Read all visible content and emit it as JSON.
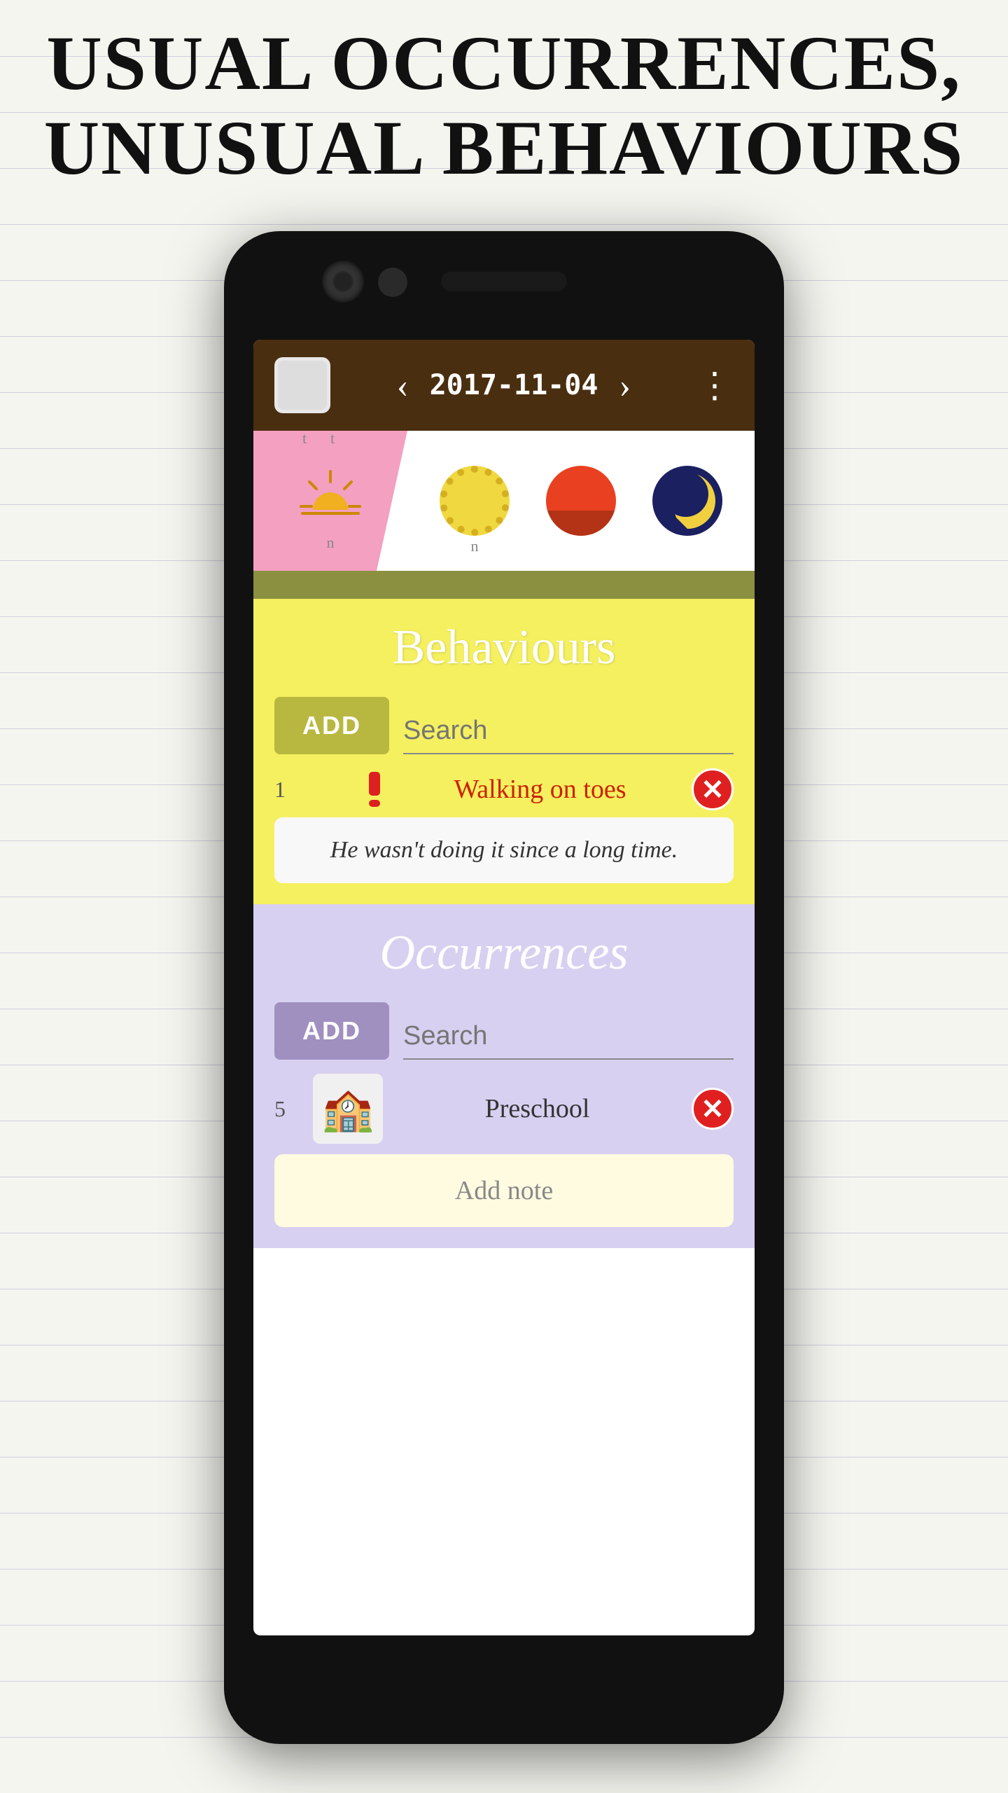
{
  "page": {
    "title_line1": "USUAL OCCURRENCES,",
    "title_line2": "UNUSUAL BEHAVIOURS"
  },
  "header": {
    "date": "2017-11-04",
    "menu_icon": "⋮",
    "prev_label": "‹",
    "next_label": "›"
  },
  "weather": {
    "morning_label": "t",
    "morning_label2": "t",
    "morning_label3": "n"
  },
  "behaviours": {
    "title": "Behaviours",
    "add_button": "ADD",
    "search_placeholder": "Search",
    "item_number": "1",
    "item_label": "Walking on toes",
    "note_text": "He wasn't doing it since a long time."
  },
  "occurrences": {
    "title": "Occurrences",
    "add_button": "ADD",
    "search_placeholder": "Search",
    "item_number": "5",
    "item_label": "Preschool",
    "add_note_label": "Add note"
  }
}
